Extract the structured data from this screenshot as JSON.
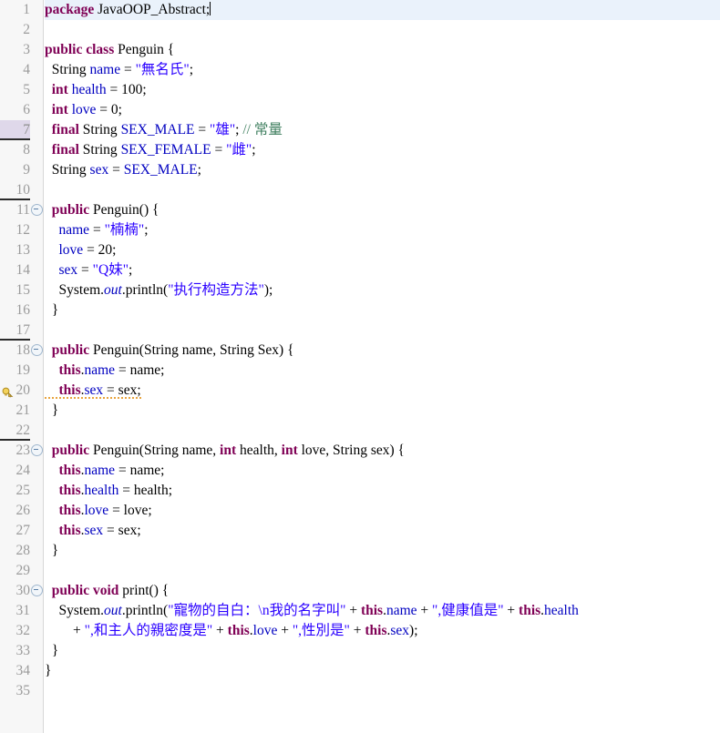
{
  "editor": {
    "name": "java-source-editor",
    "language": "Java",
    "font": "serif",
    "colors": {
      "keyword": "#7f0055",
      "field": "#0000c0",
      "string": "#2a00ff",
      "comment": "#3f7f5f",
      "plain": "#000000",
      "gutter_bg": "#f7f7f7",
      "gutter_text": "#9b9b9b",
      "current_line_bg": "#eaf2fb",
      "marked_line_bg": "#dfd8ea",
      "warning_underline": "#e8a33d"
    },
    "caret_line": 1,
    "marked_line": 7,
    "warning_line": 20,
    "fold_lines": [
      11,
      18,
      23,
      30
    ],
    "total_lines": 35
  },
  "lines": [
    {
      "num": "1",
      "current": true,
      "caret": true,
      "tokens": [
        {
          "t": "kw",
          "s": "package"
        },
        {
          "t": "pln",
          "s": " JavaOOP_Abstract;"
        }
      ]
    },
    {
      "num": "2",
      "tokens": []
    },
    {
      "num": "3",
      "tokens": [
        {
          "t": "kw",
          "s": "public class"
        },
        {
          "t": "pln",
          "s": " Penguin {"
        }
      ]
    },
    {
      "num": "4",
      "tokens": [
        {
          "t": "pln",
          "s": "  String "
        },
        {
          "t": "fld",
          "s": "name"
        },
        {
          "t": "pln",
          "s": " = "
        },
        {
          "t": "str",
          "s": "\"無名氏\""
        },
        {
          "t": "pln",
          "s": ";"
        }
      ]
    },
    {
      "num": "5",
      "tokens": [
        {
          "t": "pln",
          "s": "  "
        },
        {
          "t": "kw",
          "s": "int"
        },
        {
          "t": "pln",
          "s": " "
        },
        {
          "t": "fld",
          "s": "health"
        },
        {
          "t": "pln",
          "s": " = 100;"
        }
      ]
    },
    {
      "num": "6",
      "tokens": [
        {
          "t": "pln",
          "s": "  "
        },
        {
          "t": "kw",
          "s": "int"
        },
        {
          "t": "pln",
          "s": " "
        },
        {
          "t": "fld",
          "s": "love"
        },
        {
          "t": "pln",
          "s": " = 0;"
        }
      ]
    },
    {
      "num": "7",
      "marked": true,
      "underline_ln": true,
      "tokens": [
        {
          "t": "pln",
          "s": "  "
        },
        {
          "t": "kw",
          "s": "final"
        },
        {
          "t": "pln",
          "s": " String "
        },
        {
          "t": "fld",
          "s": "SEX_MALE"
        },
        {
          "t": "pln",
          "s": " = "
        },
        {
          "t": "str",
          "s": "\"雄\""
        },
        {
          "t": "pln",
          "s": "; "
        },
        {
          "t": "cmt",
          "s": "// 常量"
        }
      ]
    },
    {
      "num": "8",
      "tokens": [
        {
          "t": "pln",
          "s": "  "
        },
        {
          "t": "kw",
          "s": "final"
        },
        {
          "t": "pln",
          "s": " String "
        },
        {
          "t": "fld",
          "s": "SEX_FEMALE"
        },
        {
          "t": "pln",
          "s": " = "
        },
        {
          "t": "str",
          "s": "\"雌\""
        },
        {
          "t": "pln",
          "s": ";"
        }
      ]
    },
    {
      "num": "9",
      "tokens": [
        {
          "t": "pln",
          "s": "  String "
        },
        {
          "t": "fld",
          "s": "sex"
        },
        {
          "t": "pln",
          "s": " = "
        },
        {
          "t": "fld",
          "s": "SEX_MALE"
        },
        {
          "t": "pln",
          "s": ";"
        }
      ]
    },
    {
      "num": "10",
      "underline_ln": true,
      "tokens": []
    },
    {
      "num": "11",
      "fold": true,
      "tokens": [
        {
          "t": "pln",
          "s": "  "
        },
        {
          "t": "kw",
          "s": "public"
        },
        {
          "t": "pln",
          "s": " Penguin() {"
        }
      ]
    },
    {
      "num": "12",
      "tokens": [
        {
          "t": "pln",
          "s": "    "
        },
        {
          "t": "fld",
          "s": "name"
        },
        {
          "t": "pln",
          "s": " = "
        },
        {
          "t": "str",
          "s": "\"楠楠\""
        },
        {
          "t": "pln",
          "s": ";"
        }
      ]
    },
    {
      "num": "13",
      "tokens": [
        {
          "t": "pln",
          "s": "    "
        },
        {
          "t": "fld",
          "s": "love"
        },
        {
          "t": "pln",
          "s": " = 20;"
        }
      ]
    },
    {
      "num": "14",
      "tokens": [
        {
          "t": "pln",
          "s": "    "
        },
        {
          "t": "fld",
          "s": "sex"
        },
        {
          "t": "pln",
          "s": " = "
        },
        {
          "t": "str",
          "s": "\"Q妹\""
        },
        {
          "t": "pln",
          "s": ";"
        }
      ]
    },
    {
      "num": "15",
      "tokens": [
        {
          "t": "pln",
          "s": "    System."
        },
        {
          "t": "sfld",
          "s": "out"
        },
        {
          "t": "pln",
          "s": ".println("
        },
        {
          "t": "str",
          "s": "\"执行构造方法\""
        },
        {
          "t": "pln",
          "s": ");"
        }
      ]
    },
    {
      "num": "16",
      "tokens": [
        {
          "t": "pln",
          "s": "  }"
        }
      ]
    },
    {
      "num": "17",
      "underline_ln": true,
      "tokens": []
    },
    {
      "num": "18",
      "fold": true,
      "tokens": [
        {
          "t": "pln",
          "s": "  "
        },
        {
          "t": "kw",
          "s": "public"
        },
        {
          "t": "pln",
          "s": " Penguin(String name, String Sex) {"
        }
      ]
    },
    {
      "num": "19",
      "tokens": [
        {
          "t": "pln",
          "s": "    "
        },
        {
          "t": "th",
          "s": "this"
        },
        {
          "t": "pln",
          "s": "."
        },
        {
          "t": "fld",
          "s": "name"
        },
        {
          "t": "pln",
          "s": " = name;"
        }
      ]
    },
    {
      "num": "20",
      "bulb": true,
      "warn": true,
      "tokens": [
        {
          "t": "pln",
          "s": "    "
        },
        {
          "t": "th",
          "s": "this"
        },
        {
          "t": "pln",
          "s": "."
        },
        {
          "t": "fld",
          "s": "sex"
        },
        {
          "t": "pln",
          "s": " = sex;"
        }
      ]
    },
    {
      "num": "21",
      "tokens": [
        {
          "t": "pln",
          "s": "  }"
        }
      ]
    },
    {
      "num": "22",
      "underline_ln": true,
      "tokens": []
    },
    {
      "num": "23",
      "fold": true,
      "tokens": [
        {
          "t": "pln",
          "s": "  "
        },
        {
          "t": "kw",
          "s": "public"
        },
        {
          "t": "pln",
          "s": " Penguin(String name, "
        },
        {
          "t": "kw",
          "s": "int"
        },
        {
          "t": "pln",
          "s": " health, "
        },
        {
          "t": "kw",
          "s": "int"
        },
        {
          "t": "pln",
          "s": " love, String sex) {"
        }
      ]
    },
    {
      "num": "24",
      "tokens": [
        {
          "t": "pln",
          "s": "    "
        },
        {
          "t": "th",
          "s": "this"
        },
        {
          "t": "pln",
          "s": "."
        },
        {
          "t": "fld",
          "s": "name"
        },
        {
          "t": "pln",
          "s": " = name;"
        }
      ]
    },
    {
      "num": "25",
      "tokens": [
        {
          "t": "pln",
          "s": "    "
        },
        {
          "t": "th",
          "s": "this"
        },
        {
          "t": "pln",
          "s": "."
        },
        {
          "t": "fld",
          "s": "health"
        },
        {
          "t": "pln",
          "s": " = health;"
        }
      ]
    },
    {
      "num": "26",
      "tokens": [
        {
          "t": "pln",
          "s": "    "
        },
        {
          "t": "th",
          "s": "this"
        },
        {
          "t": "pln",
          "s": "."
        },
        {
          "t": "fld",
          "s": "love"
        },
        {
          "t": "pln",
          "s": " = love;"
        }
      ]
    },
    {
      "num": "27",
      "tokens": [
        {
          "t": "pln",
          "s": "    "
        },
        {
          "t": "th",
          "s": "this"
        },
        {
          "t": "pln",
          "s": "."
        },
        {
          "t": "fld",
          "s": "sex"
        },
        {
          "t": "pln",
          "s": " = sex;"
        }
      ]
    },
    {
      "num": "28",
      "tokens": [
        {
          "t": "pln",
          "s": "  }"
        }
      ]
    },
    {
      "num": "29",
      "tokens": []
    },
    {
      "num": "30",
      "fold": true,
      "tokens": [
        {
          "t": "pln",
          "s": "  "
        },
        {
          "t": "kw",
          "s": "public void"
        },
        {
          "t": "pln",
          "s": " print() {"
        }
      ]
    },
    {
      "num": "31",
      "tokens": [
        {
          "t": "pln",
          "s": "    System."
        },
        {
          "t": "sfld",
          "s": "out"
        },
        {
          "t": "pln",
          "s": ".println("
        },
        {
          "t": "str",
          "s": "\"寵物的自白：\\n我的名字叫\""
        },
        {
          "t": "pln",
          "s": " + "
        },
        {
          "t": "th",
          "s": "this"
        },
        {
          "t": "pln",
          "s": "."
        },
        {
          "t": "fld",
          "s": "name"
        },
        {
          "t": "pln",
          "s": " + "
        },
        {
          "t": "str",
          "s": "\",健康值是\""
        },
        {
          "t": "pln",
          "s": " + "
        },
        {
          "t": "th",
          "s": "this"
        },
        {
          "t": "pln",
          "s": "."
        },
        {
          "t": "fld",
          "s": "health"
        }
      ]
    },
    {
      "num": "32",
      "tokens": [
        {
          "t": "pln",
          "s": "        + "
        },
        {
          "t": "str",
          "s": "\",和主人的親密度是\""
        },
        {
          "t": "pln",
          "s": " + "
        },
        {
          "t": "th",
          "s": "this"
        },
        {
          "t": "pln",
          "s": "."
        },
        {
          "t": "fld",
          "s": "love"
        },
        {
          "t": "pln",
          "s": " + "
        },
        {
          "t": "str",
          "s": "\",性別是\""
        },
        {
          "t": "pln",
          "s": " + "
        },
        {
          "t": "th",
          "s": "this"
        },
        {
          "t": "pln",
          "s": "."
        },
        {
          "t": "fld",
          "s": "sex"
        },
        {
          "t": "pln",
          "s": ");"
        }
      ]
    },
    {
      "num": "33",
      "tokens": [
        {
          "t": "pln",
          "s": "  }"
        }
      ]
    },
    {
      "num": "34",
      "tokens": [
        {
          "t": "pln",
          "s": "}"
        }
      ]
    },
    {
      "num": "35",
      "tokens": []
    }
  ]
}
